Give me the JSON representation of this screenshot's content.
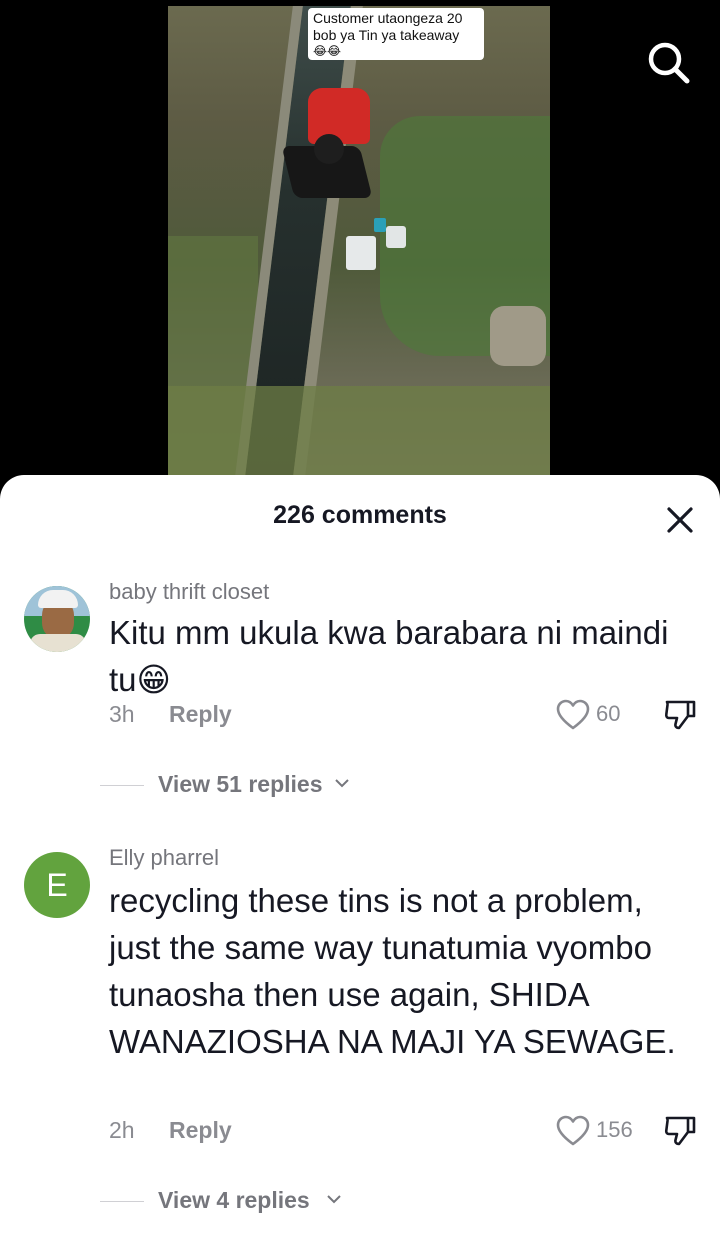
{
  "video": {
    "caption_line1": "Customer utaongeza 20",
    "caption_line2": "bob ya Tin ya takeaway",
    "caption_emoji": "😂😂"
  },
  "header": {
    "comments_count_label": "226 comments"
  },
  "comments": [
    {
      "username": "baby thrift closet",
      "text": "Kitu mm ukula kwa barabara ni maindi tu😁",
      "time": "3h",
      "reply_label": "Reply",
      "likes": "60",
      "view_replies_label": "View 51 replies"
    },
    {
      "username": "Elly pharrel",
      "avatar_letter": "E",
      "text": "recycling these tins is not a problem, just the same way tunatumia vyombo tunaosha then use again, SHIDA WANAZIOSHA NA MAJI YA SEWAGE.",
      "time": "2h",
      "reply_label": "Reply",
      "likes": "156",
      "view_replies_label": "View 4 replies"
    }
  ],
  "icons": {
    "search": "search-icon",
    "close": "close-icon",
    "like": "heart-outline-icon",
    "dislike": "thumbs-down-icon",
    "chevron": "chevron-down-icon"
  },
  "colors": {
    "sheet_bg": "#ffffff",
    "text_primary": "#161823",
    "text_secondary": "#8a8b91",
    "avatar_green": "#62a33e"
  }
}
